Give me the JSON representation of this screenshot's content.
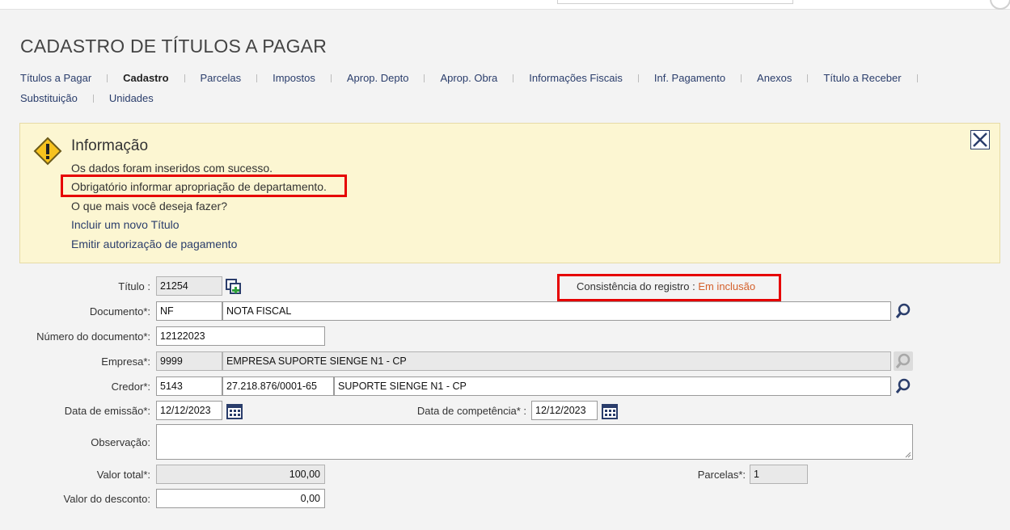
{
  "page": {
    "title": "CADASTRO DE TÍTULOS A PAGAR"
  },
  "tabs": {
    "row1": [
      "Títulos a Pagar",
      "Cadastro",
      "Parcelas",
      "Impostos",
      "Aprop. Depto",
      "Aprop. Obra",
      "Informações Fiscais",
      "Inf. Pagamento",
      "Anexos",
      "Título a Receber"
    ],
    "row2": [
      "Substituição",
      "Unidades"
    ],
    "active": "Cadastro"
  },
  "info": {
    "title": "Informação",
    "line1": "Os dados foram inseridos com sucesso.",
    "line2": "Obrigatório informar apropriação de departamento.",
    "line3": "O que mais você deseja fazer?",
    "link1": "Incluir um novo Título",
    "link2": "Emitir autorização de pagamento"
  },
  "form": {
    "titulo": {
      "label": "Título :",
      "value": "21254"
    },
    "consistencia": {
      "label": "Consistência do registro :",
      "value": "Em inclusão"
    },
    "documento": {
      "label": "Documento*:",
      "code": "NF",
      "description": "NOTA FISCAL"
    },
    "numero_documento": {
      "label": "Número do documento*:",
      "value": "12122023"
    },
    "empresa": {
      "label": "Empresa*:",
      "code": "9999",
      "name": "EMPRESA SUPORTE SIENGE N1 - CP"
    },
    "credor": {
      "label": "Credor*:",
      "code": "5143",
      "cnpj": "27.218.876/0001-65",
      "name": "SUPORTE SIENGE N1 - CP"
    },
    "data_emissao": {
      "label": "Data de emissão*:",
      "value": "12/12/2023"
    },
    "data_competencia": {
      "label": "Data de competência* :",
      "value": "12/12/2023"
    },
    "observacao": {
      "label": "Observação:",
      "value": ""
    },
    "valor_total": {
      "label": "Valor total*:",
      "value": "100,00"
    },
    "parcelas": {
      "label": "Parcelas*:",
      "value": "1"
    },
    "valor_desconto": {
      "label": "Valor do desconto:",
      "value": "0,00"
    }
  },
  "icons": {
    "warning": "warning-icon",
    "close": "close-icon",
    "copy": "copy-icon",
    "search": "search-icon",
    "calendar": "calendar-icon"
  },
  "colors": {
    "link": "#2a3d6b",
    "info_bg": "#fcf6d2",
    "highlight": "#e60000",
    "status": "#d4602b"
  }
}
